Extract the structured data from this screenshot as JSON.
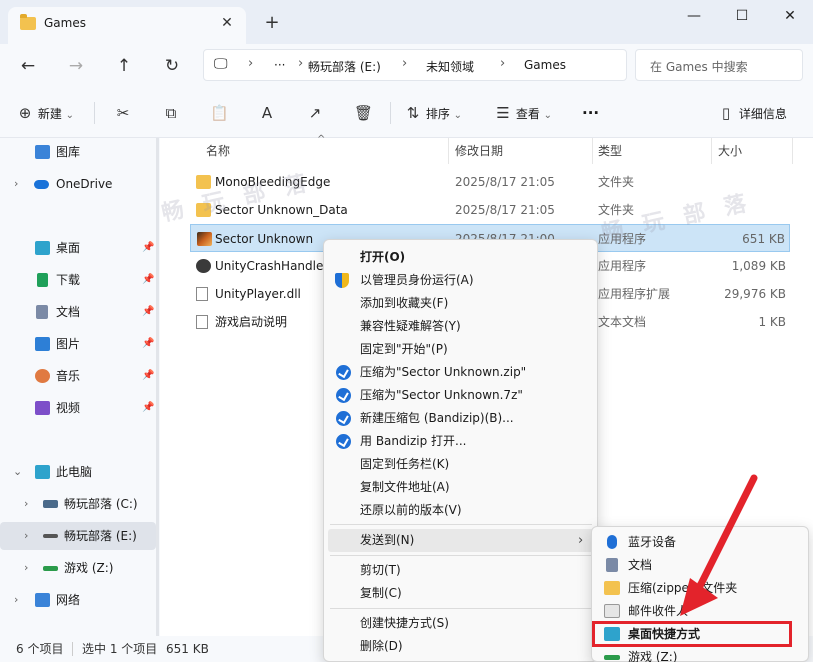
{
  "window": {
    "tab_title": "Games",
    "close_glyph": "✕",
    "new_tab_glyph": "+",
    "min_glyph": "—",
    "max_glyph": "☐",
    "winclose_glyph": "✕"
  },
  "nav": {
    "back_glyph": "←",
    "forward_glyph": "→",
    "up_glyph": "↑",
    "refresh_glyph": "↻"
  },
  "address": {
    "monitor_glyph": "🖵",
    "more": "···",
    "sep": "›",
    "crumbs": [
      "畅玩部落 (E:)",
      "未知领域",
      "Games"
    ]
  },
  "search": {
    "placeholder": "在 Games 中搜索"
  },
  "toolbar": {
    "new_label": "新建",
    "sort_label": "排序",
    "view_label": "查看",
    "more": "···",
    "details_label": "详细信息",
    "plus_glyph": "⊕",
    "cut_glyph": "✂",
    "copy_glyph": "⧉",
    "paste_glyph": "📋",
    "rename_glyph": "A",
    "share_glyph": "↗",
    "delete_glyph": "🗑",
    "sort_glyph": "⇅",
    "view_glyph": "☰",
    "details_glyph": "▯",
    "caret": "⌄"
  },
  "sidebar": {
    "pin": "📌",
    "chev_right": "›",
    "chev_down": "⌄",
    "items": [
      {
        "label": "图库"
      },
      {
        "label": "OneDrive"
      },
      {
        "label": "桌面"
      },
      {
        "label": "下载"
      },
      {
        "label": "文档"
      },
      {
        "label": "图片"
      },
      {
        "label": "音乐"
      },
      {
        "label": "视频"
      },
      {
        "label": "此电脑"
      },
      {
        "label": "畅玩部落 (C:)"
      },
      {
        "label": "畅玩部落 (E:)"
      },
      {
        "label": "游戏 (Z:)"
      },
      {
        "label": "网络"
      }
    ]
  },
  "columns": {
    "name": "名称",
    "date": "修改日期",
    "type": "类型",
    "size": "大小"
  },
  "files": [
    {
      "name": "MonoBleedingEdge",
      "date": "2025/8/17 21:05",
      "type": "文件夹",
      "size": ""
    },
    {
      "name": "Sector Unknown_Data",
      "date": "2025/8/17 21:05",
      "type": "文件夹",
      "size": ""
    },
    {
      "name": "Sector Unknown",
      "date": "2025/8/17 21:00",
      "type": "应用程序",
      "size": "651 KB"
    },
    {
      "name": "UnityCrashHandler",
      "date": "",
      "type": "应用程序",
      "size": "1,089 KB"
    },
    {
      "name": "UnityPlayer.dll",
      "date": "",
      "type": "应用程序扩展",
      "size": "29,976 KB"
    },
    {
      "name": "游戏启动说明",
      "date": "",
      "type": "文本文档",
      "size": "1 KB"
    }
  ],
  "context_menu": {
    "items": [
      "打开(O)",
      "以管理员身份运行(A)",
      "添加到收藏夹(F)",
      "兼容性疑难解答(Y)",
      "固定到\"开始\"(P)",
      "压缩为\"Sector Unknown.zip\"",
      "压缩为\"Sector Unknown.7z\"",
      "新建压缩包 (Bandizip)(B)...",
      "用 Bandizip 打开...",
      "固定到任务栏(K)",
      "复制文件地址(A)",
      "还原以前的版本(V)",
      "发送到(N)",
      "剪切(T)",
      "复制(C)",
      "创建快捷方式(S)",
      "删除(D)"
    ],
    "submenu_arrow": "›"
  },
  "send_to": {
    "items": [
      "蓝牙设备",
      "文档",
      "压缩(zipped)文件夹",
      "邮件收件人",
      "桌面快捷方式",
      "游戏 (Z:)"
    ]
  },
  "status": {
    "count": "6 个项目",
    "selected": "选中 1 个项目",
    "size": "651 KB"
  },
  "colors": {
    "accent": "#1f6fd6",
    "selection": "#cce4f7",
    "highlight": "#e3232b"
  }
}
